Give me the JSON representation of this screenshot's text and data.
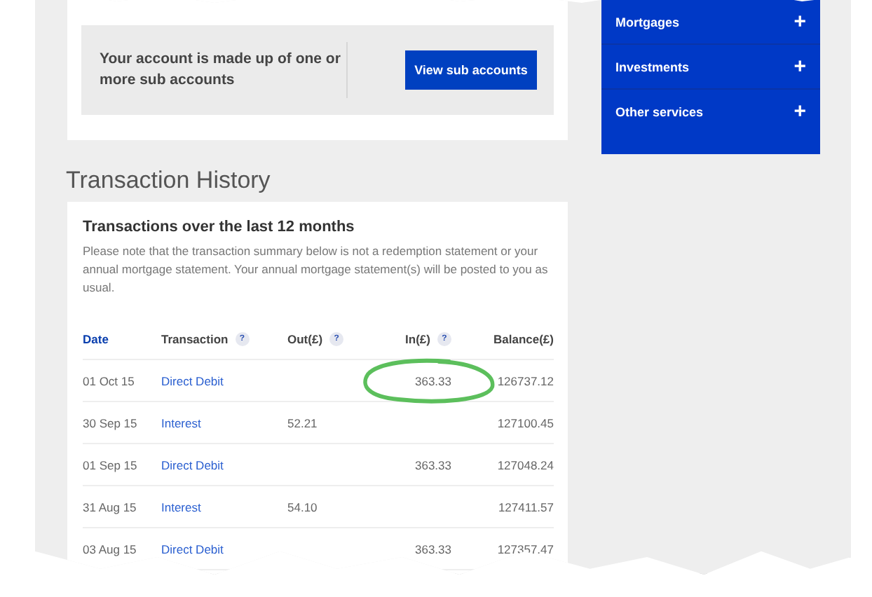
{
  "sub_accounts": {
    "message": "Your account is made up of one or more sub accounts",
    "button": "View sub accounts"
  },
  "menu": [
    {
      "label": "Mortgages",
      "icon": "+"
    },
    {
      "label": "Investments",
      "icon": "+"
    },
    {
      "label": "Other services",
      "icon": "+"
    }
  ],
  "section_title": "Transaction History",
  "card": {
    "title": "Transactions over the last 12 months",
    "note": "Please note that the transaction summary below is not a redemption statement or your annual mortgage statement. Your annual mortgage statement(s) will be posted to you as usual."
  },
  "table": {
    "columns": [
      {
        "label": "Date",
        "selected": true
      },
      {
        "label": "Transaction",
        "selected": false,
        "help": "?"
      },
      {
        "label": "Out(£)",
        "selected": false,
        "help": "?"
      },
      {
        "label": "In(£)",
        "selected": false,
        "help": "?"
      },
      {
        "label": "Balance(£)",
        "selected": false
      }
    ],
    "rows": [
      {
        "date": "01 Oct 15",
        "transaction": "Direct Debit",
        "out": "",
        "in": "363.33",
        "balance": "126737.12",
        "circled": true
      },
      {
        "date": "30 Sep 15",
        "transaction": "Interest",
        "out": "52.21",
        "in": "",
        "balance": "127100.45",
        "circled": false
      },
      {
        "date": "01 Sep 15",
        "transaction": "Direct Debit",
        "out": "",
        "in": "363.33",
        "balance": "127048.24",
        "circled": false
      },
      {
        "date": "31 Aug 15",
        "transaction": "Interest",
        "out": "54.10",
        "in": "",
        "balance": "127411.57",
        "circled": false
      },
      {
        "date": "03 Aug 15",
        "transaction": "Direct Debit",
        "out": "",
        "in": "363.33",
        "balance": "127357.47",
        "circled": false
      }
    ]
  }
}
